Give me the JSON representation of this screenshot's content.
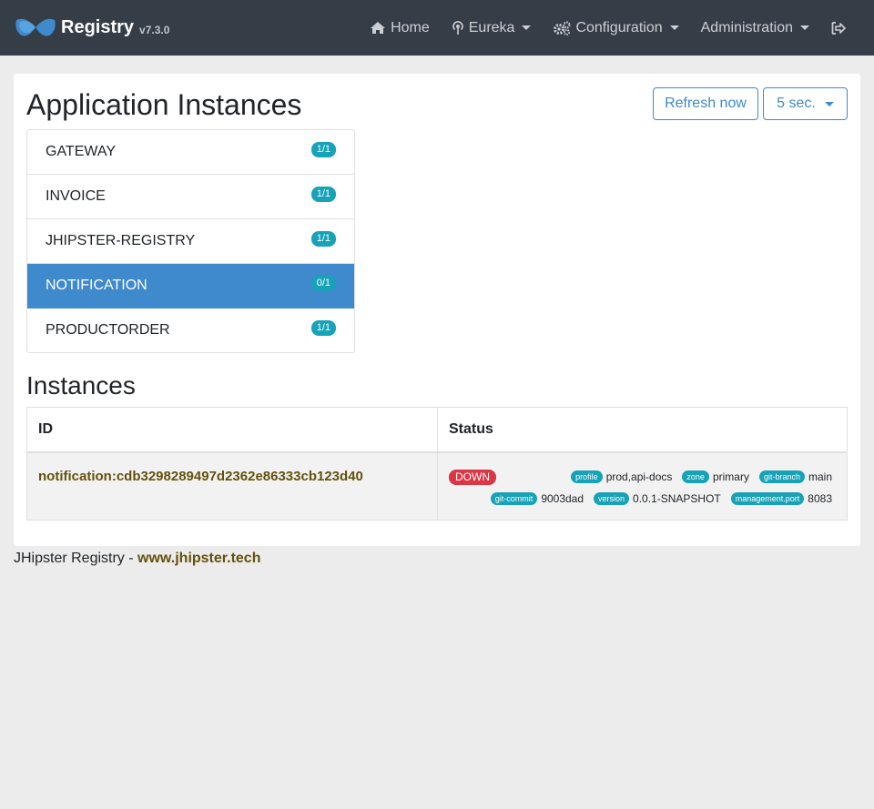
{
  "navbar": {
    "brand": "Registry",
    "version": "v7.3.0",
    "items": [
      {
        "label": "Home",
        "icon": "home-icon",
        "dropdown": false
      },
      {
        "label": "Eureka",
        "icon": "broadcast-icon",
        "dropdown": true
      },
      {
        "label": "Configuration",
        "icon": "cogs-icon",
        "dropdown": true
      },
      {
        "label": "Administration",
        "icon": "",
        "dropdown": true
      }
    ],
    "logout_icon": "sign-out-icon"
  },
  "page": {
    "title": "Application Instances",
    "refresh_label": "Refresh now",
    "interval_label": "5 sec."
  },
  "applications": [
    {
      "name": "GATEWAY",
      "count": "1/1",
      "active": false
    },
    {
      "name": "INVOICE",
      "count": "1/1",
      "active": false
    },
    {
      "name": "JHIPSTER-REGISTRY",
      "count": "1/1",
      "active": false
    },
    {
      "name": "NOTIFICATION",
      "count": "0/1",
      "active": true
    },
    {
      "name": "PRODUCTORDER",
      "count": "1/1",
      "active": false
    }
  ],
  "instances": {
    "title": "Instances",
    "columns": [
      "ID",
      "Status"
    ],
    "rows": [
      {
        "id": "notification:cdb3298289497d2362e86333cb123d40",
        "status": "DOWN",
        "metadata": [
          {
            "key": "profile",
            "value": "prod,api-docs"
          },
          {
            "key": "zone",
            "value": "primary"
          },
          {
            "key": "git-branch",
            "value": "main"
          },
          {
            "key": "git-commit",
            "value": "9003dad"
          },
          {
            "key": "version",
            "value": "0.0.1-SNAPSHOT"
          },
          {
            "key": "management.port",
            "value": "8083"
          }
        ]
      }
    ]
  },
  "footer": {
    "text": "JHipster Registry - ",
    "link": "www.jhipster.tech"
  },
  "colors": {
    "navbar": "#353d47",
    "primary": "#3e8acc",
    "info_badge": "#17a2b8",
    "danger": "#dc3545",
    "link": "#63510b"
  }
}
